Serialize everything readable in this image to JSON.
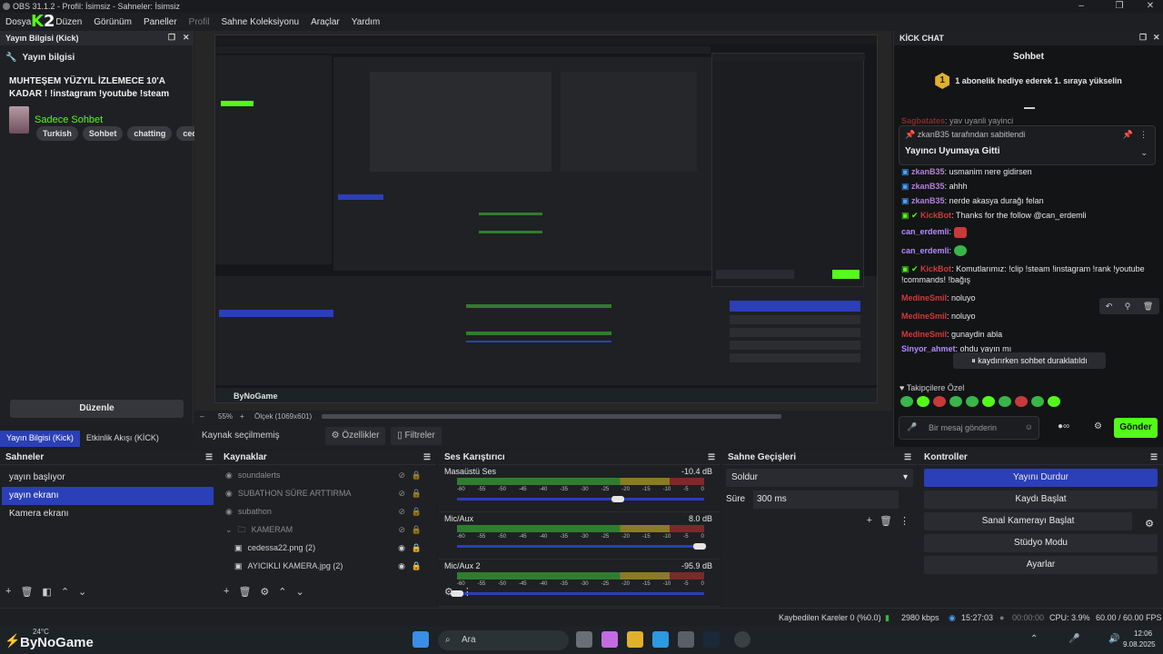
{
  "window": {
    "title": "OBS 31.1.2 - Profil: İsimsiz - Sahneler: İsimsiz",
    "minimize": "–",
    "maximize": "❐",
    "close": "✕"
  },
  "menu": [
    "Dosya",
    "Düzen",
    "Görünüm",
    "Paneller",
    "Profil",
    "Sahne Koleksiyonu",
    "Araçlar",
    "Yardım"
  ],
  "logo": {
    "k": "K",
    "n": "2"
  },
  "left_dock": {
    "header": "Yayın Bilgisi (Kick)",
    "section": "Yayın bilgisi",
    "stream_title": "MUHTEŞEM YÜZYIL İZLEMECE 10'A KADAR ! !instagram !youtube !steam",
    "category": "Sadece Sohbet",
    "tags": [
      "Turkish",
      "Sohbet",
      "chatting",
      "cedes"
    ],
    "edit_button": "Düzenle"
  },
  "left_tabs": [
    "Yayın Bilgisi (Kick)",
    "Etkinlik Akışı (KİCK)"
  ],
  "preview": {
    "zoom": "55%",
    "scale": "Ölçek (1069x601)"
  },
  "source_bar": {
    "label": "Kaynak seçilmemiş",
    "properties": "Özellikler",
    "filters": "Filtreler"
  },
  "chat": {
    "header": "KİCK CHAT",
    "tab": "Sohbet",
    "gift": "1 abonelik hediye ederek 1. sıraya yükselin",
    "gift_rank": "1",
    "pinned_by": "zkanB35 tarafından sabitlendi",
    "pinned_text": "Yayıncı Uyumaya Gitti",
    "messages": [
      {
        "user": "Sagbatates",
        "text": "yav uyanli yayinci",
        "cls": "u3"
      },
      {
        "user": "zkanB35",
        "text": "usmanim nere gidirsen",
        "cls": "u1"
      },
      {
        "user": "zkanB35",
        "text": "ahhh",
        "cls": "u1"
      },
      {
        "user": "zkanB35",
        "text": "nerde akasya durağı felan",
        "cls": "u1"
      },
      {
        "user": "KickBot",
        "text": "Thanks for the follow @can_erdemli",
        "cls": "u3"
      },
      {
        "user": "can_erdemli",
        "text": "",
        "cls": "u5"
      },
      {
        "user": "can_erdemli",
        "text": "",
        "cls": "u5"
      },
      {
        "user": "KickBot",
        "text": "Komutlarımız: !clip !steam !instagram !rank !youtube !commands! !bağış",
        "cls": "u3"
      },
      {
        "user": "MedineSmil",
        "text": "noluyo",
        "cls": "u3"
      },
      {
        "user": "MedineSmil",
        "text": "noluyo",
        "cls": "u3"
      },
      {
        "user": "MedineSmil",
        "text": "gunaydin abla",
        "cls": "u3"
      },
      {
        "user": "Sinyor_ahmet",
        "text": "ohdu yayın mı",
        "cls": "u5"
      }
    ],
    "paused": "kaydırırken sohbet duraklatıldı",
    "followers_only": "Takipçilere Özel",
    "input_placeholder": "Bir mesaj gönderin",
    "send": "Gönder"
  },
  "scenes": {
    "header": "Sahneler",
    "items": [
      "yayın başlıyor",
      "yayın ekranı",
      "Kamera ekranı"
    ],
    "selected": 1
  },
  "sources": {
    "header": "Kaynaklar",
    "items": [
      "soundalerts",
      "SUBATHON SÜRE ARTTIRMA",
      "subathon",
      "KAMERAM",
      "cedessa22.png (2)",
      "AYICIKLI KAMERA.jpg (2)"
    ]
  },
  "mixer": {
    "header": "Ses Karıştırıcı",
    "ticks": [
      "-60",
      "-55",
      "-50",
      "-45",
      "-40",
      "-35",
      "-30",
      "-25",
      "-20",
      "-15",
      "-10",
      "-5",
      "0"
    ],
    "channels": [
      {
        "name": "Masaüstü Ses",
        "db": "-10.4 dB",
        "volume": 0.65
      },
      {
        "name": "Mic/Aux",
        "db": "8.0 dB",
        "volume": 0.98
      },
      {
        "name": "Mic/Aux 2",
        "db": "-95.9 dB",
        "volume": 0.0
      }
    ]
  },
  "transitions": {
    "header": "Sahne Geçişleri",
    "transition": "Soldur",
    "duration_label": "Süre",
    "duration": "300 ms"
  },
  "controls": {
    "header": "Kontroller",
    "buttons": [
      "Yayını Durdur",
      "Kaydı Başlat",
      "Sanal Kamerayı Başlat",
      "Stüdyo Modu",
      "Ayarlar"
    ]
  },
  "status": {
    "dropped": "Kaybedilen Kareler 0 (%0.0)",
    "bitrate": "2980 kbps",
    "stream_time": "15:27:03",
    "rec_time": "00:00:00",
    "cpu": "CPU: 3.9%",
    "fps": "60.00 / 60.00 FPS"
  },
  "taskbar": {
    "weather": "24°C",
    "brand": "ByNoGame",
    "search": "Ara",
    "time": "12:06",
    "date": "9.08.2025"
  },
  "colors": {
    "kick_green": "#53fc18",
    "selection_blue": "#2a3fb8"
  }
}
